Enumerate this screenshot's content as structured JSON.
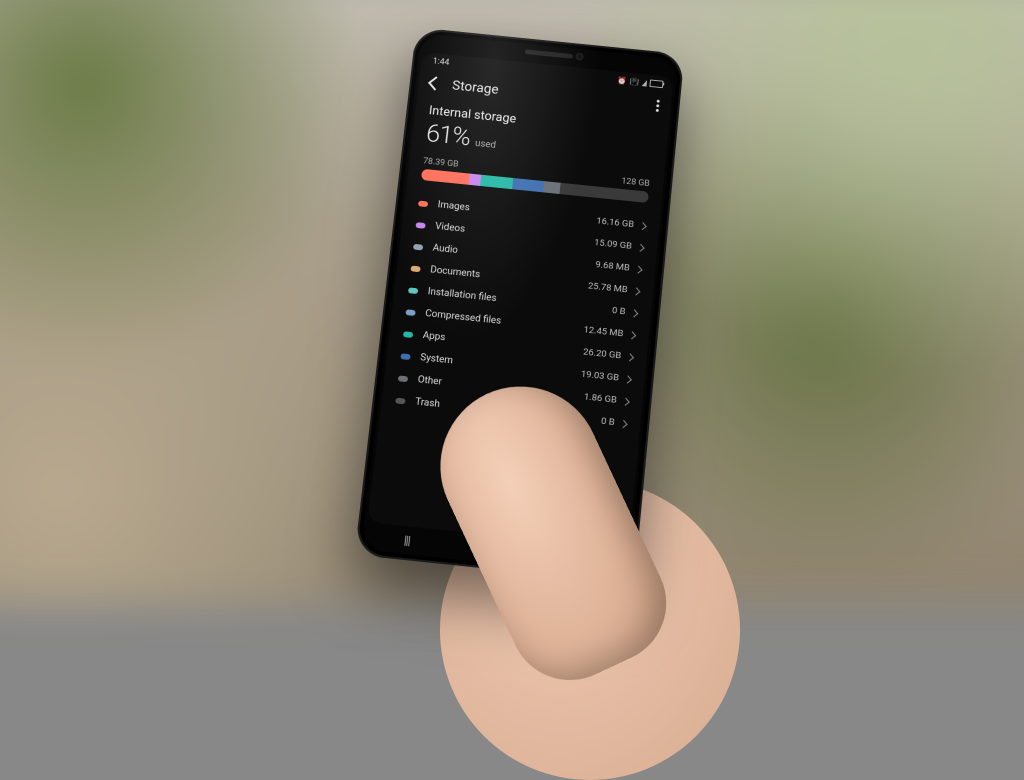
{
  "status": {
    "time": "1:44"
  },
  "header": {
    "title": "Storage"
  },
  "storage": {
    "section": "Internal storage",
    "percent": "61%",
    "used_label": "used",
    "used_value": "78.39 GB",
    "total_value": "128 GB"
  },
  "bar_segments": [
    {
      "color": "#ff6e58",
      "width": 21
    },
    {
      "color": "#c784ef",
      "width": 5
    },
    {
      "color": "#25b7a5",
      "width": 14
    },
    {
      "color": "#3f6fb0",
      "width": 14
    },
    {
      "color": "#6a6f78",
      "width": 7
    },
    {
      "color": "#3a3a3a",
      "width": 39
    }
  ],
  "categories": [
    {
      "name": "Images",
      "size": "16.16 GB",
      "color": "#ff6e58"
    },
    {
      "name": "Videos",
      "size": "15.09 GB",
      "color": "#c784ef"
    },
    {
      "name": "Audio",
      "size": "9.68 MB",
      "color": "#8fa1b3"
    },
    {
      "name": "Documents",
      "size": "25.78 MB",
      "color": "#e0a96d"
    },
    {
      "name": "Installation files",
      "size": "0 B",
      "color": "#5ec6c0"
    },
    {
      "name": "Compressed files",
      "size": "12.45 MB",
      "color": "#7aa0c4"
    },
    {
      "name": "Apps",
      "size": "26.20 GB",
      "color": "#25b7a5"
    },
    {
      "name": "System",
      "size": "19.03 GB",
      "color": "#3f6fb0"
    },
    {
      "name": "Other",
      "size": "1.86 GB",
      "color": "#6a6f78"
    },
    {
      "name": "Trash",
      "size": "0 B",
      "color": "#555"
    }
  ]
}
